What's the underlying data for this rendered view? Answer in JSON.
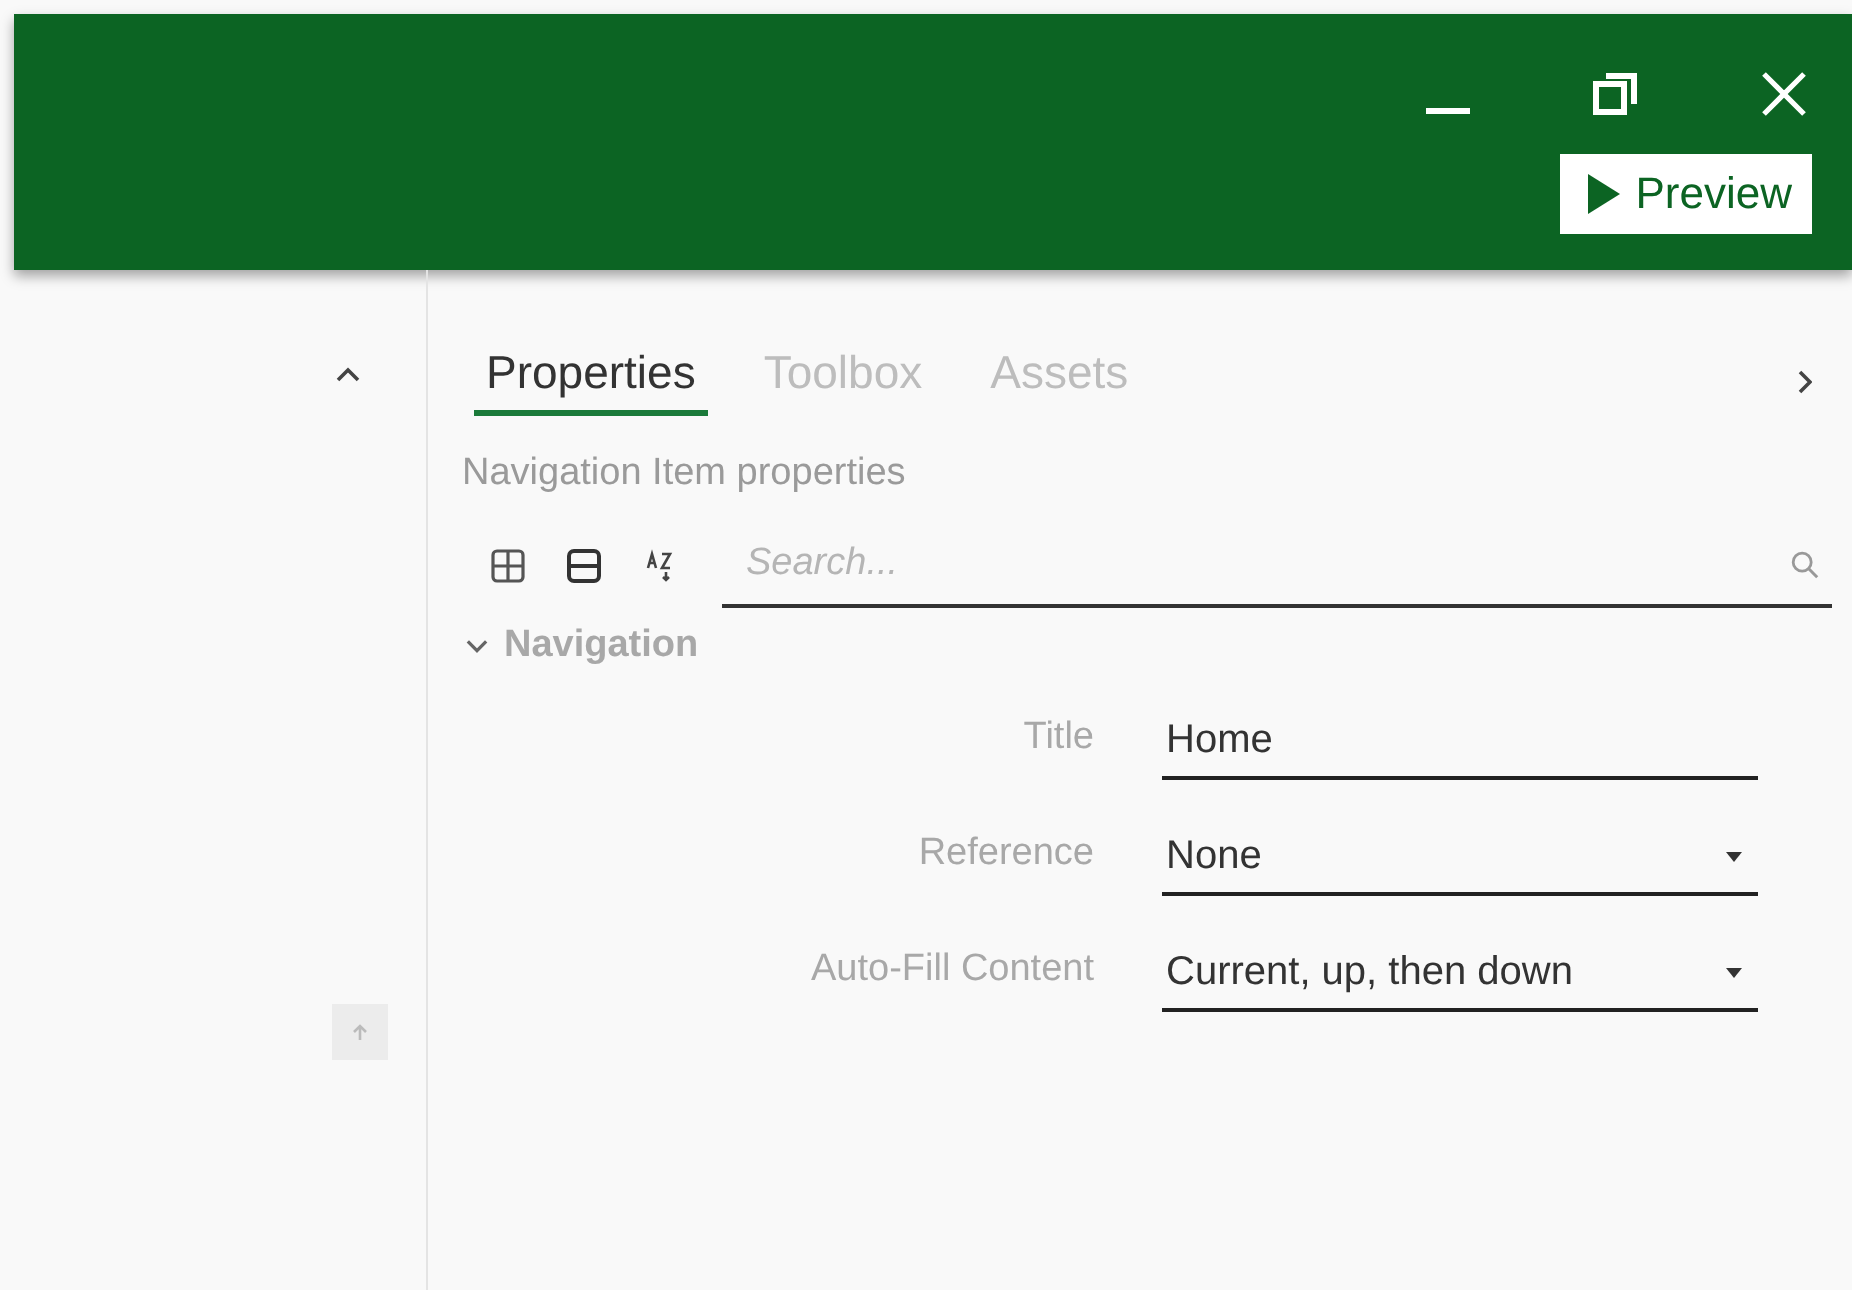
{
  "window": {
    "controls": [
      {
        "kind": "minimize"
      },
      {
        "kind": "restore"
      },
      {
        "kind": "close"
      }
    ]
  },
  "preview_button": {
    "label": "Preview"
  },
  "tabs": [
    {
      "label": "Properties",
      "selected": true
    },
    {
      "label": "Toolbox",
      "selected": false
    },
    {
      "label": "Assets",
      "selected": false
    }
  ],
  "subtitle": "Navigation Item properties",
  "search": {
    "placeholder": "Search..."
  },
  "group": {
    "label": "Navigation",
    "expanded": true,
    "fields": [
      {
        "label": "Title",
        "kind": "text",
        "value": "Home"
      },
      {
        "label": "Reference",
        "kind": "dropdown",
        "value": "None"
      },
      {
        "label": "Auto-Fill Content",
        "kind": "dropdown",
        "value": "Current, up, then down"
      }
    ]
  }
}
